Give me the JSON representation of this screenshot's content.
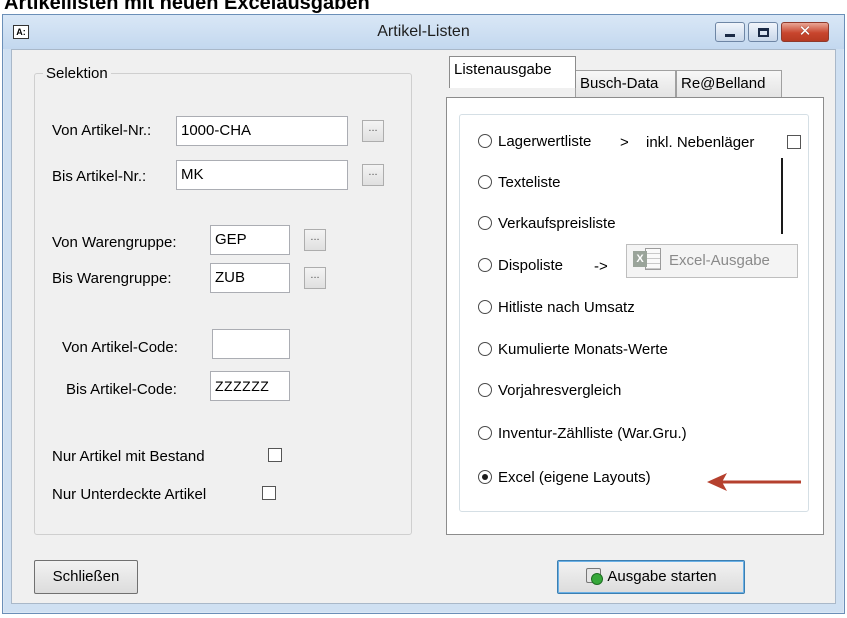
{
  "page_heading": "Artikellisten mit neuen Excelausgaben",
  "window": {
    "title": "Artikel-Listen",
    "icon_label": "A:",
    "close_glyph": "✕"
  },
  "selection": {
    "title": "Selektion",
    "from_article_label": "Von Artikel-Nr.:",
    "from_article_value": "1000-CHA",
    "to_article_label": "Bis Artikel-Nr.:",
    "to_article_value": "MK",
    "from_group_label": "Von Warengruppe:",
    "from_group_value": "GEP",
    "to_group_label": "Bis Warengruppe:",
    "to_group_value": "ZUB",
    "from_code_label": "Von Artikel-Code:",
    "from_code_value": "",
    "to_code_label": "Bis Artikel-Code:",
    "to_code_value": "ZZZZZZ",
    "browse_label": "...",
    "only_stock_label": "Nur Artikel mit Bestand",
    "only_stock_checked": false,
    "only_undercovered_label": "Nur Unterdeckte Artikel",
    "only_undercovered_checked": false
  },
  "tabs": [
    {
      "label": "Listenausgabe",
      "active": true
    },
    {
      "label": "Busch-Data",
      "active": false
    },
    {
      "label": "Re@Belland",
      "active": false
    }
  ],
  "list_options": [
    {
      "label": "Lagerwertliste",
      "checked": false
    },
    {
      "label": "Texteliste",
      "checked": false
    },
    {
      "label": "Verkaufspreisliste",
      "checked": false
    },
    {
      "label": "Dispoliste",
      "checked": false
    },
    {
      "label": "Hitliste nach Umsatz",
      "checked": false
    },
    {
      "label": "Kumulierte Monats-Werte",
      "checked": false
    },
    {
      "label": "Vorjahresvergleich",
      "checked": false
    },
    {
      "label": "Inventur-Zählliste (War.Gru.)",
      "checked": false
    },
    {
      "label": "Excel (eigene Layouts)",
      "checked": true
    }
  ],
  "lagerwert_suffix": ">",
  "nebenlaeger_label": "inkl. Nebenläger",
  "nebenlaeger_checked": false,
  "dispo_arrow": "->",
  "excel_button_label": "Excel-Ausgabe",
  "excel_icon_letter": "X",
  "buttons": {
    "close": "Schließen",
    "start": "Ausgabe starten"
  },
  "colors": {
    "arrow": "#b5402e",
    "titlebar": "#c8dbef",
    "close_button": "#c8452d"
  },
  "icons": {
    "window_icon": "app-icon",
    "excel": "excel-icon",
    "start": "start-icon",
    "pointer": "arrow-left-icon"
  }
}
